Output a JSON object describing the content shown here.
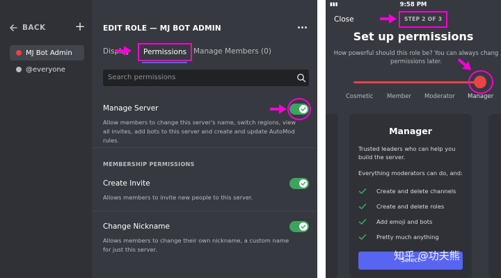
{
  "colors": {
    "background": "#36393f",
    "sidebar": "#2f3136",
    "accent": "#5865f2",
    "toggle_on": "#3ba55d",
    "danger": "#ed4245",
    "annotation": "#f900d8",
    "role_admin": "#ed4245",
    "role_everyone": "#b9bbbe"
  },
  "desktop": {
    "sidebar": {
      "back_label": "BACK",
      "roles": [
        {
          "label": "MJ Bot Admin",
          "color": "#ed4245",
          "selected": true
        },
        {
          "label": "@everyone",
          "color": "#b9bbbe",
          "selected": false
        }
      ]
    },
    "header": {
      "title": "EDIT ROLE — MJ BOT ADMIN"
    },
    "tabs": [
      {
        "label": "Display"
      },
      {
        "label": "Permissions",
        "selected": true
      },
      {
        "label": "Manage Members (0)"
      }
    ],
    "search": {
      "placeholder": "Search permissions"
    },
    "permissions": [
      {
        "title": "Manage Server",
        "description": "Allow members to change this server's name, switch regions, view all invites, add bots to this server and create and update AutoMod rules.",
        "enabled": true
      }
    ],
    "section": {
      "title": "MEMBERSHIP PERMISSIONS",
      "items": [
        {
          "title": "Create Invite",
          "description": "Allows members to invite new people to this server.",
          "enabled": true
        },
        {
          "title": "Change Nickname",
          "description": "Allows members to change their own nickname, a custom name for just this server.",
          "enabled": true
        }
      ]
    }
  },
  "mobile": {
    "status_time": "9:58 PM",
    "close_label": "Close",
    "step_label": "STEP 2 OF 3",
    "title": "Set up permissions",
    "subtitle_line1": "How powerful should this role be? You can always chang",
    "subtitle_line2": "permissions later.",
    "levels": [
      "Cosmetic",
      "Member",
      "Moderator",
      "Manager"
    ],
    "slider_value": "Manager",
    "card": {
      "title": "Manager",
      "description": "Trusted leaders who can help you build the server.",
      "subtitle": "Everything moderators can do, and:",
      "items": [
        "Create and delete channels",
        "Create and delete roles",
        "Add emoji and bots",
        "Pretty much anything"
      ],
      "button_label": "Select"
    },
    "watermark": "知乎 @功夫熊"
  }
}
